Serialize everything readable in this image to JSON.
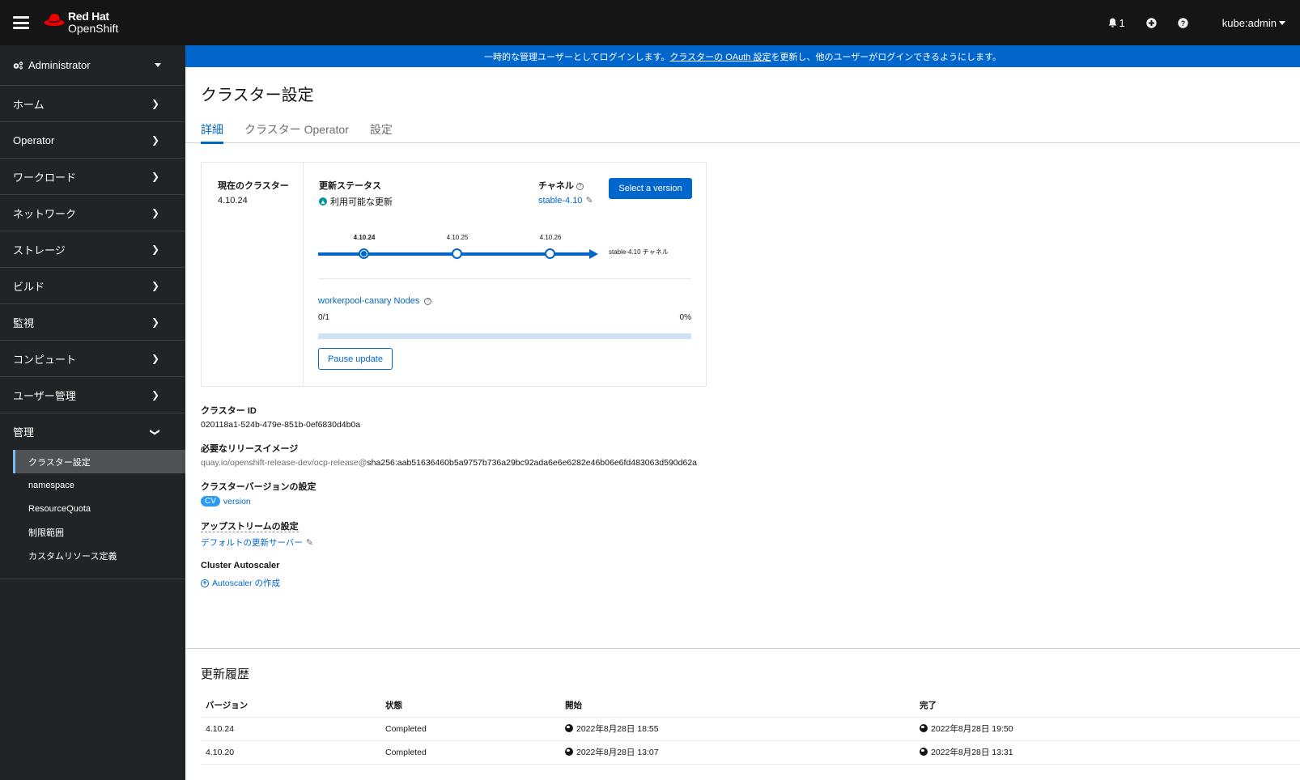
{
  "masthead": {
    "brand_line1": "Red Hat",
    "brand_line2": "OpenShift",
    "notifications_count": "1",
    "user": "kube:admin",
    "icons": [
      "hamburger-icon",
      "redhat-logo",
      "bell-icon",
      "plus-circle-icon",
      "help-icon",
      "caret-down-icon"
    ]
  },
  "sidebar": {
    "perspective": "Administrator",
    "items": [
      {
        "label": "ホーム"
      },
      {
        "label": "Operator"
      },
      {
        "label": "ワークロード"
      },
      {
        "label": "ネットワーク"
      },
      {
        "label": "ストレージ"
      },
      {
        "label": "ビルド"
      },
      {
        "label": "監視"
      },
      {
        "label": "コンピュート"
      },
      {
        "label": "ユーザー管理"
      },
      {
        "label": "管理",
        "expanded": true
      }
    ],
    "subitems": [
      {
        "label": "クラスター設定",
        "active": true
      },
      {
        "label": "namespace"
      },
      {
        "label": "ResourceQuota"
      },
      {
        "label": "制限範囲"
      },
      {
        "label": "カスタムリソース定義"
      }
    ]
  },
  "banner": {
    "prefix": "一時的な管理ユーザーとしてログインします。",
    "link": "クラスターの OAuth 設定",
    "suffix": "を更新し、他のユーザーがログインできるようにします。"
  },
  "page": {
    "title": "クラスター設定",
    "tabs": [
      {
        "label": "詳細",
        "active": true
      },
      {
        "label": "クラスター Operator"
      },
      {
        "label": "設定"
      }
    ]
  },
  "update_card": {
    "current_cluster_label": "現在のクラスター",
    "current_version": "4.10.24",
    "update_status_label": "更新ステータス",
    "update_status": "利用可能な更新",
    "channel_label": "チャネル",
    "channel": "stable-4.10",
    "select_version_button": "Select a version",
    "timeline": {
      "versions": [
        "4.10.24",
        "4.10.25",
        "4.10.26"
      ],
      "current_index": 0,
      "channel_label": "stable-4.10 チャネル"
    },
    "pool_link": "workerpool-canary Nodes",
    "pool_count": "0/1",
    "pool_percent": "0%",
    "pool_progress": 0,
    "pause_button": "Pause update"
  },
  "details": {
    "cluster_id_label": "クラスター ID",
    "cluster_id": "020118a1-524b-479e-851b-0ef6830d4b0a",
    "release_image_label": "必要なリリースイメージ",
    "release_image_repo": "quay.io/openshift-release-dev/ocp-release@",
    "release_image_digest": "sha256:aab51636460b5a9757b736a29bc92ada6e6e6282e46b06e6fd483063d590d62a",
    "cv_label": "クラスターバージョンの設定",
    "cv_badge": "CV",
    "cv_link": "version",
    "upstream_label": "アップストリームの設定",
    "upstream_link": "デフォルトの更新サーバー",
    "autoscaler_label": "Cluster Autoscaler",
    "autoscaler_link": "Autoscaler の作成"
  },
  "history": {
    "title": "更新履歴",
    "columns": [
      "バージョン",
      "状態",
      "開始",
      "完了"
    ],
    "rows": [
      {
        "version": "4.10.24",
        "state": "Completed",
        "started": "2022年8月28日 18:55",
        "completed": "2022年8月28日 19:50"
      },
      {
        "version": "4.10.20",
        "state": "Completed",
        "started": "2022年8月28日 13:07",
        "completed": "2022年8月28日 13:31"
      }
    ]
  }
}
